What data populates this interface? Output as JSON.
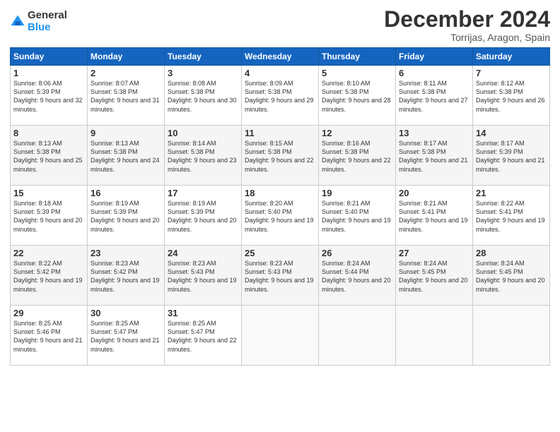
{
  "logo": {
    "general": "General",
    "blue": "Blue"
  },
  "header": {
    "month": "December 2024",
    "location": "Torrijas, Aragon, Spain"
  },
  "weekdays": [
    "Sunday",
    "Monday",
    "Tuesday",
    "Wednesday",
    "Thursday",
    "Friday",
    "Saturday"
  ],
  "weeks": [
    [
      {
        "day": "1",
        "sunrise": "8:06 AM",
        "sunset": "5:39 PM",
        "daylight": "9 hours and 32 minutes."
      },
      {
        "day": "2",
        "sunrise": "8:07 AM",
        "sunset": "5:38 PM",
        "daylight": "9 hours and 31 minutes."
      },
      {
        "day": "3",
        "sunrise": "8:08 AM",
        "sunset": "5:38 PM",
        "daylight": "9 hours and 30 minutes."
      },
      {
        "day": "4",
        "sunrise": "8:09 AM",
        "sunset": "5:38 PM",
        "daylight": "9 hours and 29 minutes."
      },
      {
        "day": "5",
        "sunrise": "8:10 AM",
        "sunset": "5:38 PM",
        "daylight": "9 hours and 28 minutes."
      },
      {
        "day": "6",
        "sunrise": "8:11 AM",
        "sunset": "5:38 PM",
        "daylight": "9 hours and 27 minutes."
      },
      {
        "day": "7",
        "sunrise": "8:12 AM",
        "sunset": "5:38 PM",
        "daylight": "9 hours and 26 minutes."
      }
    ],
    [
      {
        "day": "8",
        "sunrise": "8:13 AM",
        "sunset": "5:38 PM",
        "daylight": "9 hours and 25 minutes."
      },
      {
        "day": "9",
        "sunrise": "8:13 AM",
        "sunset": "5:38 PM",
        "daylight": "9 hours and 24 minutes."
      },
      {
        "day": "10",
        "sunrise": "8:14 AM",
        "sunset": "5:38 PM",
        "daylight": "9 hours and 23 minutes."
      },
      {
        "day": "11",
        "sunrise": "8:15 AM",
        "sunset": "5:38 PM",
        "daylight": "9 hours and 22 minutes."
      },
      {
        "day": "12",
        "sunrise": "8:16 AM",
        "sunset": "5:38 PM",
        "daylight": "9 hours and 22 minutes."
      },
      {
        "day": "13",
        "sunrise": "8:17 AM",
        "sunset": "5:38 PM",
        "daylight": "9 hours and 21 minutes."
      },
      {
        "day": "14",
        "sunrise": "8:17 AM",
        "sunset": "5:39 PM",
        "daylight": "9 hours and 21 minutes."
      }
    ],
    [
      {
        "day": "15",
        "sunrise": "8:18 AM",
        "sunset": "5:39 PM",
        "daylight": "9 hours and 20 minutes."
      },
      {
        "day": "16",
        "sunrise": "8:19 AM",
        "sunset": "5:39 PM",
        "daylight": "9 hours and 20 minutes."
      },
      {
        "day": "17",
        "sunrise": "8:19 AM",
        "sunset": "5:39 PM",
        "daylight": "9 hours and 20 minutes."
      },
      {
        "day": "18",
        "sunrise": "8:20 AM",
        "sunset": "5:40 PM",
        "daylight": "9 hours and 19 minutes."
      },
      {
        "day": "19",
        "sunrise": "8:21 AM",
        "sunset": "5:40 PM",
        "daylight": "9 hours and 19 minutes."
      },
      {
        "day": "20",
        "sunrise": "8:21 AM",
        "sunset": "5:41 PM",
        "daylight": "9 hours and 19 minutes."
      },
      {
        "day": "21",
        "sunrise": "8:22 AM",
        "sunset": "5:41 PM",
        "daylight": "9 hours and 19 minutes."
      }
    ],
    [
      {
        "day": "22",
        "sunrise": "8:22 AM",
        "sunset": "5:42 PM",
        "daylight": "9 hours and 19 minutes."
      },
      {
        "day": "23",
        "sunrise": "8:23 AM",
        "sunset": "5:42 PM",
        "daylight": "9 hours and 19 minutes."
      },
      {
        "day": "24",
        "sunrise": "8:23 AM",
        "sunset": "5:43 PM",
        "daylight": "9 hours and 19 minutes."
      },
      {
        "day": "25",
        "sunrise": "8:23 AM",
        "sunset": "5:43 PM",
        "daylight": "9 hours and 19 minutes."
      },
      {
        "day": "26",
        "sunrise": "8:24 AM",
        "sunset": "5:44 PM",
        "daylight": "9 hours and 20 minutes."
      },
      {
        "day": "27",
        "sunrise": "8:24 AM",
        "sunset": "5:45 PM",
        "daylight": "9 hours and 20 minutes."
      },
      {
        "day": "28",
        "sunrise": "8:24 AM",
        "sunset": "5:45 PM",
        "daylight": "9 hours and 20 minutes."
      }
    ],
    [
      {
        "day": "29",
        "sunrise": "8:25 AM",
        "sunset": "5:46 PM",
        "daylight": "9 hours and 21 minutes."
      },
      {
        "day": "30",
        "sunrise": "8:25 AM",
        "sunset": "5:47 PM",
        "daylight": "9 hours and 21 minutes."
      },
      {
        "day": "31",
        "sunrise": "8:25 AM",
        "sunset": "5:47 PM",
        "daylight": "9 hours and 22 minutes."
      },
      null,
      null,
      null,
      null
    ]
  ]
}
